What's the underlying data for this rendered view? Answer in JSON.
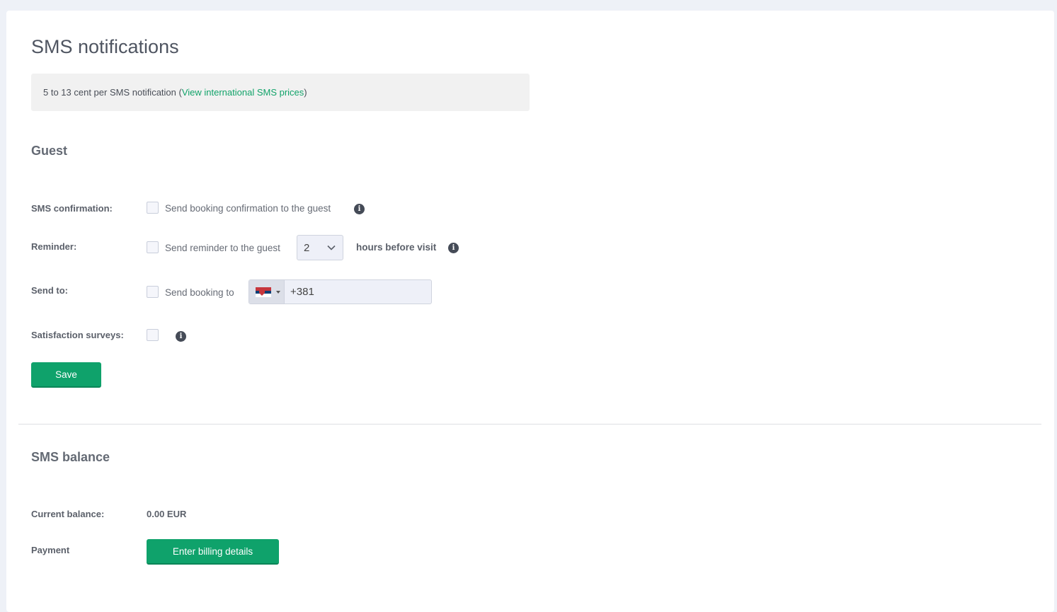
{
  "page": {
    "title": "SMS notifications"
  },
  "info": {
    "text_before": "5 to 13 cent per SMS notification (",
    "link": "View international SMS prices",
    "text_after": ")"
  },
  "guest": {
    "section_title": "Guest",
    "sms_confirmation": {
      "label": "SMS confirmation:",
      "checkbox_text": "Send booking confirmation to the guest",
      "checked": false
    },
    "reminder": {
      "label": "Reminder:",
      "checkbox_text": "Send reminder to the guest",
      "checked": false,
      "hours_value": "2",
      "suffix": "hours before visit"
    },
    "send_to": {
      "label": "Send to:",
      "checkbox_text": "Send booking to",
      "checked": false,
      "phone_value": "+381",
      "country_flag": "serbia-flag-icon"
    },
    "satisfaction": {
      "label": "Satisfaction surveys:",
      "checked": false
    },
    "save_label": "Save"
  },
  "balance": {
    "section_title": "SMS balance",
    "current_label": "Current balance:",
    "current_value": "0.00 EUR",
    "payment_label": "Payment",
    "billing_button": "Enter billing details"
  },
  "colors": {
    "accent": "#0fa26b",
    "link": "#12a36a"
  }
}
